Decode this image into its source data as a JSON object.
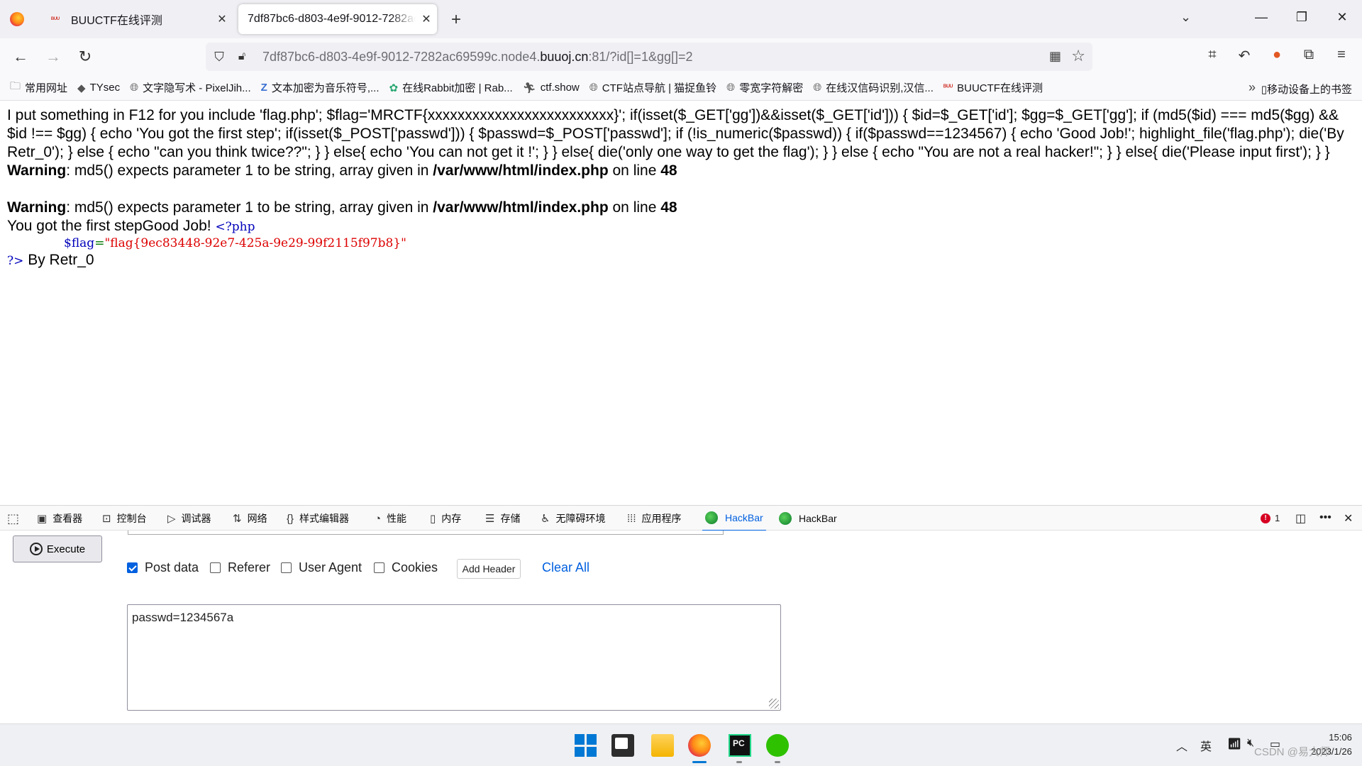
{
  "browser": {
    "tabs": [
      {
        "title": "BUUCTF在线评测",
        "favicon": "buuctf-icon",
        "active": false
      },
      {
        "title": "7df87bc6-d803-4e9f-9012-7282ac69599c.node4.buuoj.cn:81/?id[]=1&gg[]=2",
        "active": true
      }
    ],
    "url_prefix": "7df87bc6-d803-4e9f-9012-7282ac69599c.node4.",
    "url_domain": "buuoj.cn",
    "url_suffix": ":81/?id[]=1&gg[]=2",
    "bookmarks": [
      {
        "label": "常用网址",
        "icon": "folder-icon"
      },
      {
        "label": "TYsec",
        "icon": "mask-icon"
      },
      {
        "label": "文字隐写术 - PixelJih...",
        "icon": "globe-icon"
      },
      {
        "label": "文本加密为音乐符号,...",
        "icon": "z-icon"
      },
      {
        "label": "在线Rabbit加密 | Rab...",
        "icon": "gear-icon"
      },
      {
        "label": "ctf.show",
        "icon": "runner-icon"
      },
      {
        "label": "CTF站点导航 | 猫捉鱼铃",
        "icon": "globe-icon"
      },
      {
        "label": "零宽字符解密",
        "icon": "globe-icon"
      },
      {
        "label": "在线汉信码识别,汉信...",
        "icon": "globe-icon"
      },
      {
        "label": "BUUCTF在线评测",
        "icon": "buuctf-icon"
      }
    ],
    "mobile_bookmarks": "移动设备上的书签"
  },
  "page": {
    "source_text": "I put something in F12 for you include 'flag.php'; $flag='MRCTF{xxxxxxxxxxxxxxxxxxxxxxxxx}'; if(isset($_GET['gg'])&&isset($_GET['id'])) { $id=$_GET['id']; $gg=$_GET['gg']; if (md5($id) === md5($gg) && $id !== $gg) { echo 'You got the first step'; if(isset($_POST['passwd'])) { $passwd=$_POST['passwd']; if (!is_numeric($passwd)) { if($passwd==1234567) { echo 'Good Job!'; highlight_file('flag.php'); die('By Retr_0'); } else { echo \"can you think twice??\"; } } else{ echo 'You can not get it !'; } } else{ die('only one way to get the flag'); } } else { echo \"You are not a real hacker!\"; } } else{ die('Please input first'); } }",
    "warnings": [
      {
        "label": "Warning",
        "message": ": md5() expects parameter 1 to be string, array given in ",
        "path": "/var/www/html/index.php",
        "on_line": " on line ",
        "line": "48"
      },
      {
        "label": "Warning",
        "message": ": md5() expects parameter 1 to be string, array given in ",
        "path": "/var/www/html/index.php",
        "on_line": " on line ",
        "line": "48"
      }
    ],
    "result_text": "You got the first stepGood Job!",
    "php_open": "<?php",
    "flag_var": "$flag",
    "flag_eq": "=",
    "flag_value": "\"flag{9ec83448-92e7-425a-9e29-99f2115f97b8}\"",
    "php_close": "?>",
    "by_text": "By Retr_0"
  },
  "devtools": {
    "tabs": [
      {
        "label": "查看器",
        "icon": "inspector-icon"
      },
      {
        "label": "控制台",
        "icon": "console-icon"
      },
      {
        "label": "调试器",
        "icon": "debugger-icon"
      },
      {
        "label": "网络",
        "icon": "network-icon"
      },
      {
        "label": "样式编辑器",
        "icon": "style-editor-icon"
      },
      {
        "label": "性能",
        "icon": "performance-icon"
      },
      {
        "label": "内存",
        "icon": "memory-icon"
      },
      {
        "label": "存储",
        "icon": "storage-icon"
      },
      {
        "label": "无障碍环境",
        "icon": "accessibility-icon"
      },
      {
        "label": "应用程序",
        "icon": "application-icon"
      },
      {
        "label": "HackBar",
        "icon": "hackbar-icon",
        "active": true
      },
      {
        "label": "HackBar",
        "icon": "hackbar-icon",
        "active": false
      }
    ],
    "error_count": "1"
  },
  "hackbar": {
    "execute_label": "Execute",
    "options": [
      {
        "label": "Post data",
        "checked": true
      },
      {
        "label": "Referer",
        "checked": false
      },
      {
        "label": "User Agent",
        "checked": false
      },
      {
        "label": "Cookies",
        "checked": false
      }
    ],
    "add_header_label": "Add Header",
    "clear_all_label": "Clear All",
    "post_body": "passwd=1234567a"
  },
  "taskbar": {
    "ime": "英",
    "time": "15:06",
    "date": "2023/1/26",
    "watermark": "CSDN @易大师"
  },
  "colors": {
    "accent": "#0060df",
    "php_keyword": "#0000bb",
    "php_string": "#dd0000",
    "php_operator": "#007700"
  }
}
